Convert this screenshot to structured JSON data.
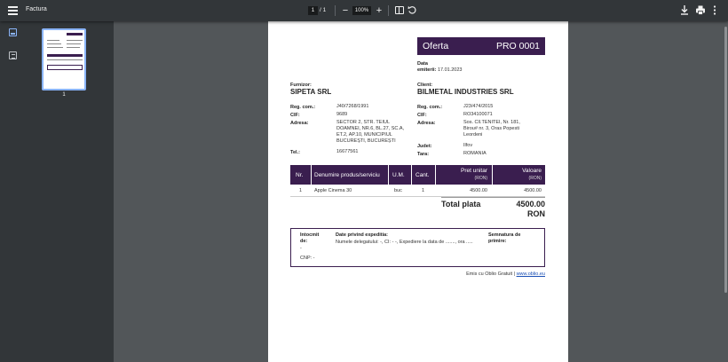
{
  "toolbar": {
    "title": "Factura",
    "page_current": "1",
    "page_total": "/ 1",
    "zoom_out": "−",
    "zoom": "100%",
    "zoom_in": "+"
  },
  "sidebar": {
    "thumbnail_label": "1"
  },
  "doc": {
    "title": "Oferta",
    "number": "PRO 0001",
    "date_label": "Data",
    "emitted_label": "emiterii:",
    "emitted_value": "17.01.2023",
    "supplier": {
      "heading": "Furnizor:",
      "name": "SIPETA SRL",
      "reg_label": "Reg. com.:",
      "reg_value": "J40/7268/1991",
      "cif_label": "CIF:",
      "cif_value": "9689",
      "addr_label": "Adresa:",
      "addr_value": "SECTOR 2, STR. TEIUL DOAMNEI, NR.6, BL.27, SC.A, ET.2, AP.10, MUNICIPIUL BUCUREȘTI, BUCUREȘTI",
      "tel_label": "Tel.:",
      "tel_value": "16677561"
    },
    "client": {
      "heading": "Client:",
      "name": "BILMETAL INDUSTRIES SRL",
      "reg_label": "Reg. com.:",
      "reg_value": "J23/474/2015",
      "cif_label": "CIF:",
      "cif_value": "RO34100071",
      "addr_label": "Adresa:",
      "addr_value": "Sos. Cll.TENITEI, Nr. 181, Birou# nr. 3, Oras Popesti Leordeni",
      "county_label": "Judet:",
      "county_value": "Ilfov",
      "country_label": "Tara:",
      "country_value": "ROMANIA"
    },
    "table": {
      "h_nr": "Nr.",
      "h_name": "Denumire produs/serviciu",
      "h_um": "U.M.",
      "h_qty": "Cant.",
      "h_price": "Pret unitar",
      "h_price_unit": "(RON)",
      "h_value": "Valoare",
      "h_value_unit": "(RON)",
      "rows": [
        {
          "nr": "1",
          "name": "Apple Cinema 30",
          "um": "buc",
          "qty": "1",
          "price": "4500.00",
          "value": "4500.00"
        }
      ]
    },
    "total_label": "Total plata",
    "total_value": "4500.00",
    "total_currency": "RON",
    "expedition": {
      "made_by_label": "Intocmit de:",
      "made_by_dash": "-",
      "cnp": "CNP: -",
      "data_label": "Date privind expeditia:",
      "data_text": "Numele delegatului: -, CI: - -, Expediere la data de ......., ora .....",
      "signature_label": "Semnatura de primire:"
    },
    "footer_prefix": "Emis cu Oblio Gratuit |",
    "footer_link": "www.oblio.eu"
  }
}
